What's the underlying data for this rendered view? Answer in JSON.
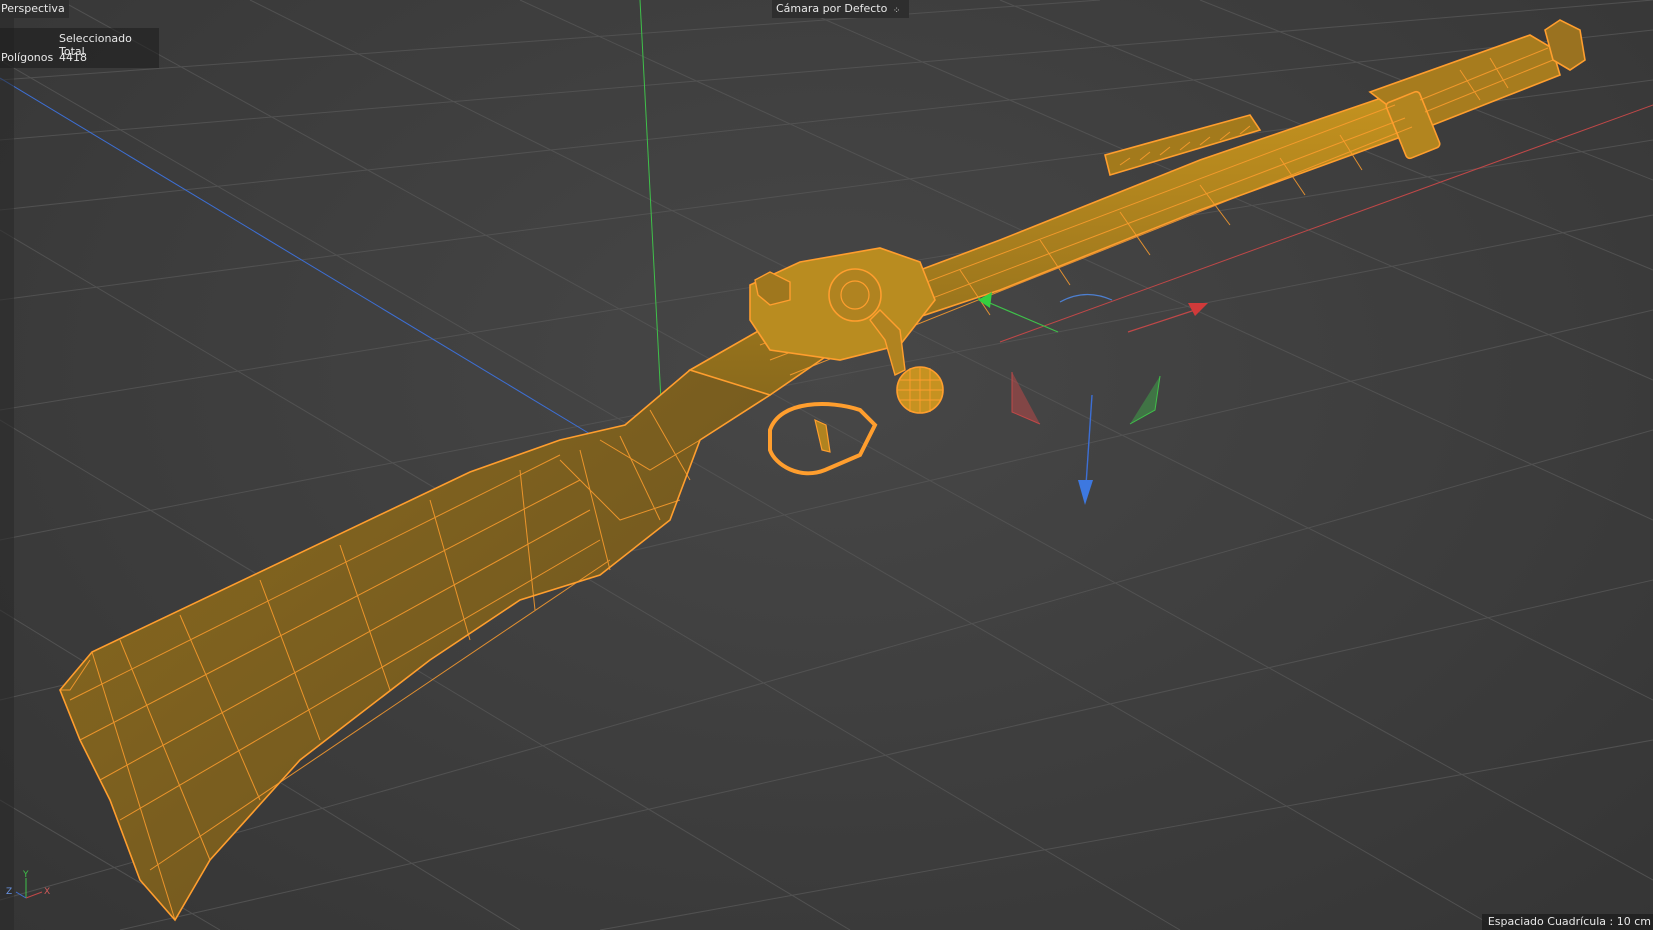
{
  "viewport": {
    "view_name": "Perspectiva",
    "camera_label": "Cámara por Defecto",
    "camera_icon": "camera-settings-icon",
    "hud": {
      "header": "Seleccionado Total",
      "rows": [
        {
          "label": "Polígonos",
          "value": "4418"
        }
      ]
    },
    "grid_spacing": "Espaciado Cuadrícula : 10 cm",
    "mini_axis": {
      "y": "Y",
      "z": "Z",
      "x": "X"
    }
  },
  "colors": {
    "background": "#3d3d3d",
    "grid_line": "#545454",
    "axis_x": "#c04848",
    "axis_y": "#3fc04a",
    "axis_z": "#3d6fd4",
    "selection_wire": "#ff9e2e",
    "selection_fill": "#b8891e"
  }
}
